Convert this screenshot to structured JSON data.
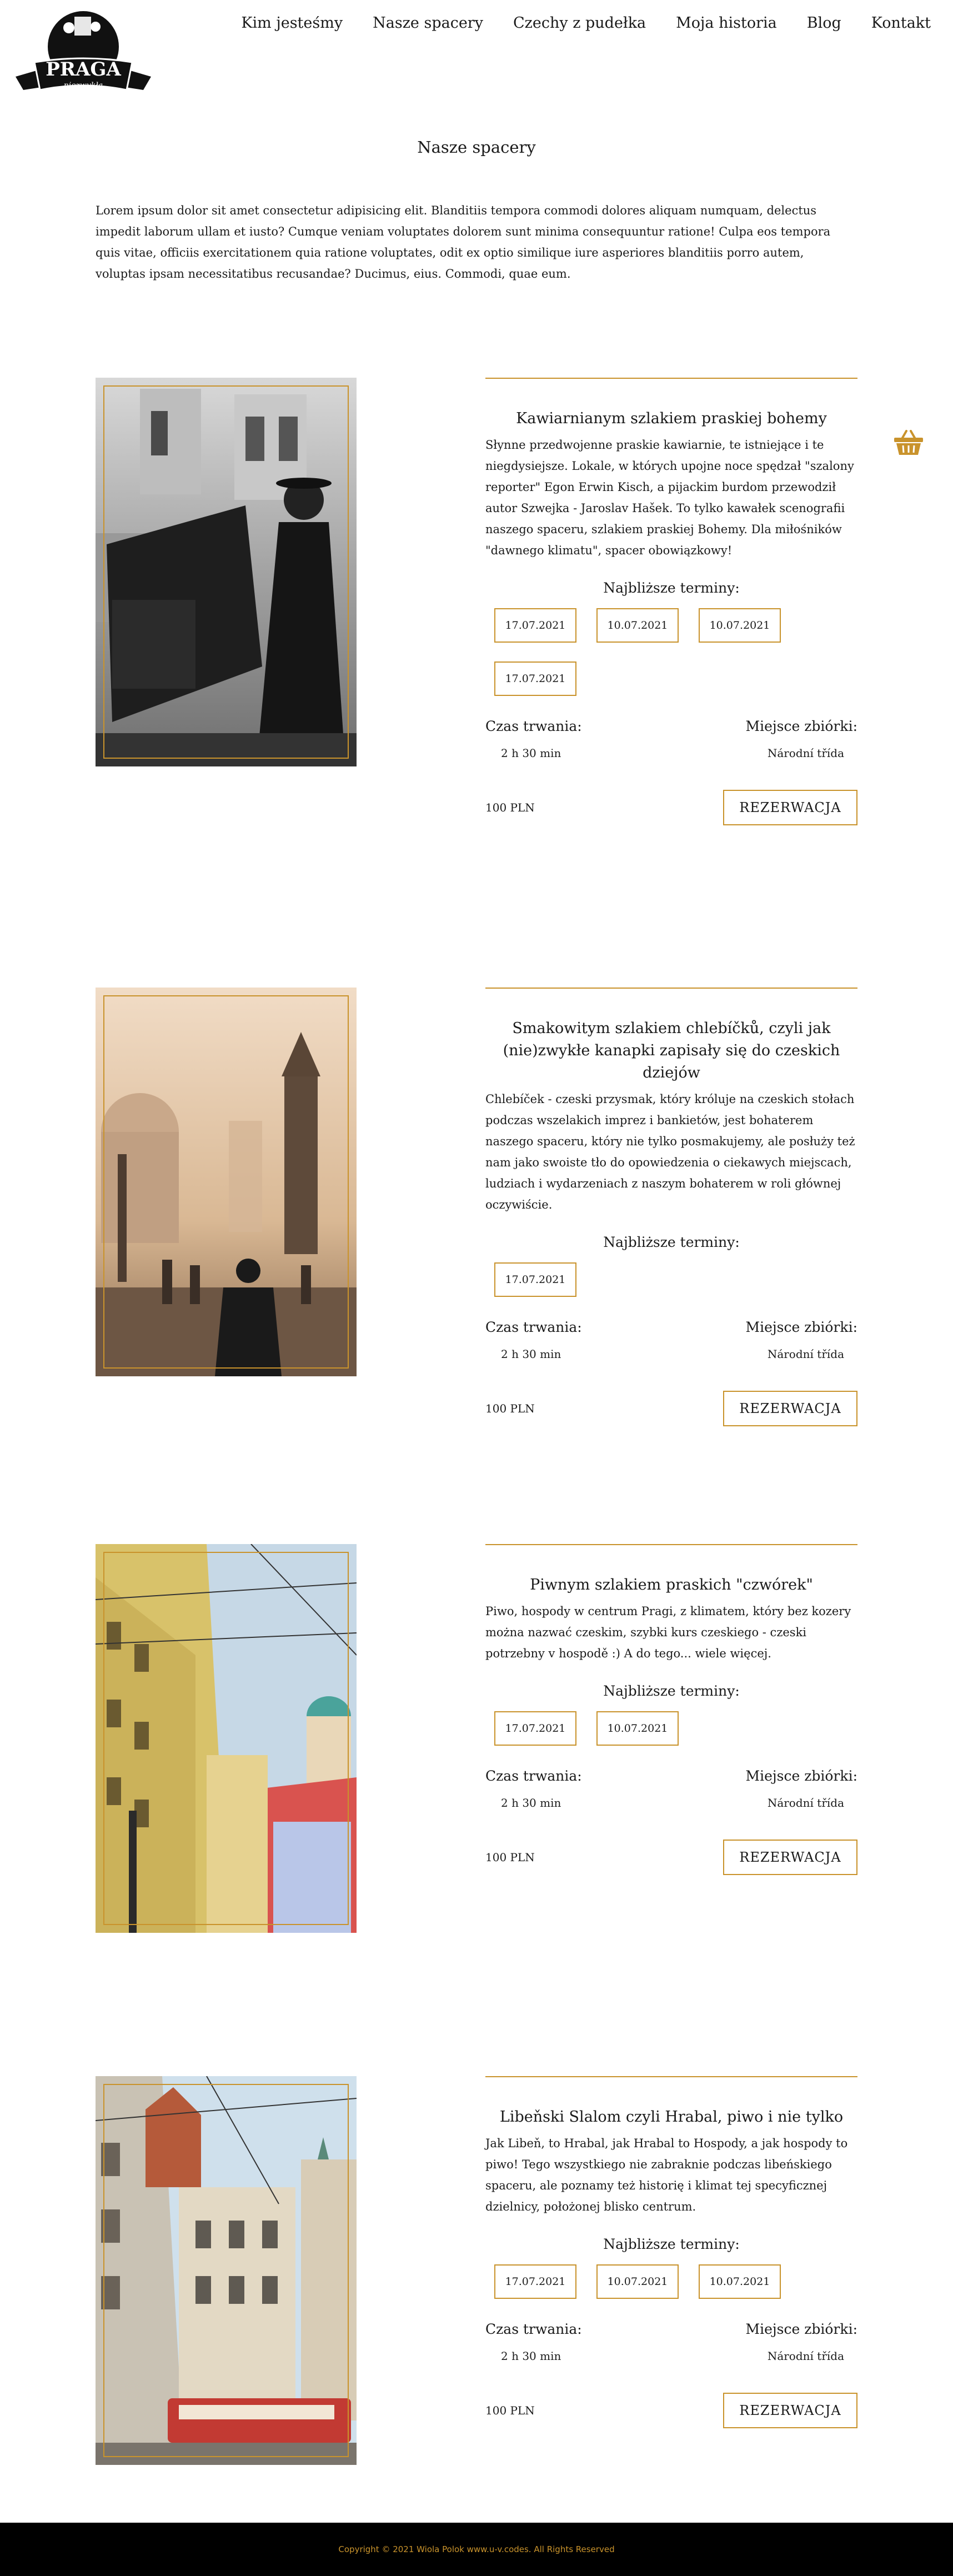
{
  "brand": {
    "logo_text": "PRAGA",
    "logo_sub": "niezwykła",
    "accent": "#c9932c"
  },
  "nav": {
    "items": [
      "Kim jesteśmy",
      "Nasze spacery",
      "Czechy z pudełka",
      "Moja historia",
      "Blog",
      "Kontakt"
    ]
  },
  "page": {
    "title": "Nasze spacery",
    "intro": "Lorem ipsum dolor sit amet consectetur adipisicing elit. Blanditiis tempora commodi dolores aliquam numquam, delectus impedit laborum ullam et iusto? Cumque veniam voluptates dolorem sunt minima consequuntur ratione! Culpa eos tempora quis vitae, officiis exercitationem quia ratione voluptates, odit ex optio similique iure asperiores blanditiis porro autem, voluptas ipsam necessitatibus recusandae? Ducimus, eius. Commodi, quae eum."
  },
  "cart": {
    "icon": "basket-icon"
  },
  "labels": {
    "dates_title": "Najbliższe terminy:",
    "duration": "Czas trwania:",
    "meeting": "Miejsce zbiórki:",
    "reserve": "REZERWACJA"
  },
  "tours": [
    {
      "title": "Kawiarnianym szlakiem praskiej bohemy",
      "description": "Słynne przedwojenne praskie kawiarnie, te istniejące i te niegdysiejsze. Lokale, w których upojne noce spędzał \"szalony reporter\" Egon Erwin Kisch, a pijackim burdom przewodził autor Szwejka - Jaroslav Hašek. To tylko kawałek scenografii naszego spaceru, szlakiem praskiej Bohemy. Dla miłośników \"dawnego klimatu\", spacer obowiązkowy!",
      "dates": [
        "17.07.2021",
        "10.07.2021",
        "10.07.2021",
        "17.07.2021"
      ],
      "duration": "2 h 30 min",
      "place": "Národní třída",
      "price": "100 PLN"
    },
    {
      "title": "Smakowitym szlakiem chlebíčků, czyli jak (nie)zwykłe kanapki zapisały się do czeskich dziejów",
      "description": "Chlebíček - czeski przysmak, który króluje na czeskich stołach podczas wszelakich imprez i bankietów, jest bohaterem naszego spaceru, który nie tylko posmakujemy, ale posłuży też nam jako swoiste tło do opowiedzenia o ciekawych miejscach, ludziach i wydarzeniach z naszym bohaterem w roli głównej oczywiście.",
      "dates": [
        "17.07.2021"
      ],
      "duration": "2 h 30 min",
      "place": "Národní třída",
      "price": "100 PLN"
    },
    {
      "title": "Piwnym szlakiem praskich \"czwórek\"",
      "description": "Piwo, hospody w centrum Pragi, z klimatem, który bez kozery można nazwać czeskim, szybki kurs czeskiego - czeski potrzebny v hospodě :) A do tego... wiele więcej.",
      "dates": [
        "17.07.2021",
        "10.07.2021"
      ],
      "duration": "2 h 30 min",
      "place": "Národní třída",
      "price": "100 PLN"
    },
    {
      "title": "Libeňski Slalom czyli Hrabal, piwo i nie tylko",
      "description": "Jak Libeň, to Hrabal, jak Hrabal to Hospody, a jak hospody to piwo! Tego wszystkiego nie zabraknie podczas libeńskiego spaceru, ale poznamy też historię i klimat tej specyficznej dzielnicy, położonej blisko centrum.",
      "dates": [
        "17.07.2021",
        "10.07.2021",
        "10.07.2021"
      ],
      "duration": "2 h 30 min",
      "place": "Národní třída",
      "price": "100 PLN"
    }
  ],
  "footer": {
    "copyright": "Copyright © 2021 Wiola Polok www.u-v.codes. All Rights Reserved"
  }
}
